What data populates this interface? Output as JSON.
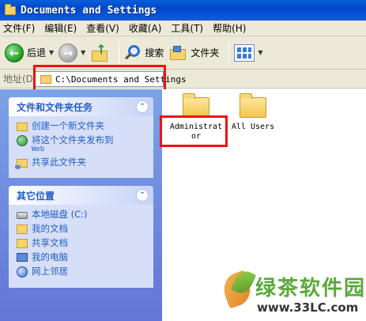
{
  "window": {
    "title": "Documents and Settings"
  },
  "menu": [
    "文件(F)",
    "编辑(E)",
    "查看(V)",
    "收藏(A)",
    "工具(T)",
    "帮助(H)"
  ],
  "toolbar": {
    "back_label": "后退",
    "search_label": "搜索",
    "folders_label": "文件夹"
  },
  "address": {
    "label": "地址(D)",
    "path": "C:\\Documents and Settings"
  },
  "tasks_panel": {
    "title": "文件和文件夹任务",
    "items": [
      {
        "label": "创建一个新文件夹",
        "sub": ""
      },
      {
        "label": "将这个文件夹发布到",
        "sub": "Web"
      },
      {
        "label": "共享此文件夹",
        "sub": ""
      }
    ]
  },
  "places_panel": {
    "title": "其它位置",
    "items": [
      "本地磁盘 (C:)",
      "我的文档",
      "共享文档",
      "我的电脑",
      "网上邻居"
    ]
  },
  "files": [
    {
      "label_line1": "Administrat",
      "label_line2": "or"
    },
    {
      "label_line1": "All Users",
      "label_line2": ""
    }
  ],
  "watermark": {
    "text": "绿茶软件园",
    "url": "www.33LC.com"
  },
  "colors": {
    "title_bar": "#0a5fd8",
    "task_pane": "#6f8fe0",
    "link": "#215dc6",
    "highlight_box": "#ee1111"
  }
}
